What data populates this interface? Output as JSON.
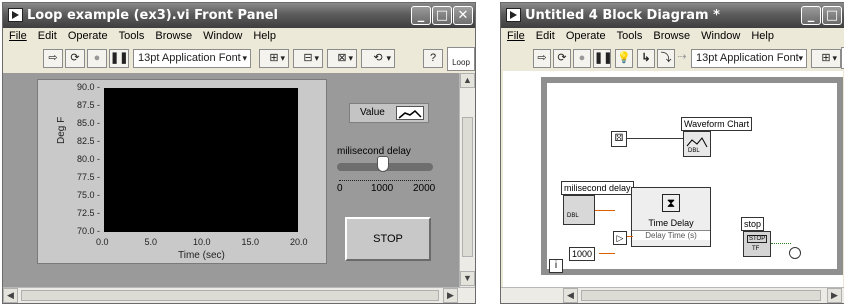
{
  "front_panel": {
    "title": "Loop example (ex3).vi Front Panel",
    "menu": [
      "File",
      "Edit",
      "Operate",
      "Tools",
      "Browse",
      "Window",
      "Help"
    ],
    "font_selector": "13pt Application Font",
    "loop_icon_label": "Loop",
    "help_label": "?",
    "chart": {
      "y_ticks": [
        "90.0",
        "87.5",
        "85.0",
        "82.5",
        "80.0",
        "77.5",
        "75.0",
        "72.5",
        "70.0"
      ],
      "x_ticks": [
        "0.0",
        "5.0",
        "10.0",
        "15.0",
        "20.0"
      ],
      "ylabel": "Deg F",
      "xlabel": "Time (sec)"
    },
    "value_label": "Value",
    "slider": {
      "label": "milisecond delay",
      "ticks": [
        "0",
        "1000",
        "2000"
      ]
    },
    "stop_label": "STOP"
  },
  "block_diagram": {
    "title": "Untitled 4 Block Diagram *",
    "menu": [
      "File",
      "Edit",
      "Operate",
      "Tools",
      "Browse",
      "Window",
      "Help"
    ],
    "font_selector": "13pt Application Font",
    "waveform_chart_label": "Waveform Chart",
    "delay_control_label": "milisecond delay",
    "time_delay_title": "Time Delay",
    "time_delay_input": "Delay Time (s)",
    "constant_value": "1000",
    "stop_label": "stop",
    "stop_button_text": "STOP",
    "tf_text": "TF",
    "dbl_text": "DBL",
    "i_label": "i",
    "icon_number": "4"
  }
}
